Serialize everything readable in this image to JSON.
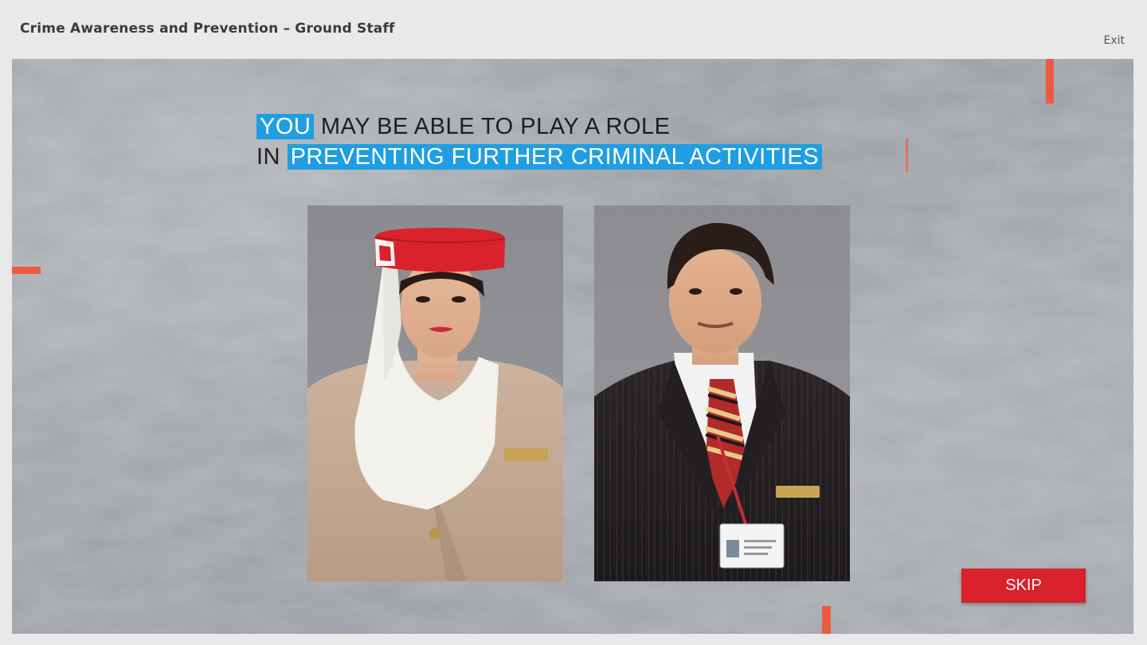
{
  "header": {
    "course_title": "Crime Awareness and Prevention – Ground Staff",
    "exit_label": "Exit"
  },
  "slide": {
    "headline": {
      "line1_highlight": "YOU",
      "line1_rest": " MAY BE ABLE TO PLAY A ROLE",
      "line2_prefix": "IN ",
      "line2_highlight": "PREVENTING FURTHER CRIMINAL ACTIVITIES"
    },
    "photos": [
      {
        "subject": "cabin-crew-member",
        "description": "Cabin crew member in beige uniform with red hat and white veil"
      },
      {
        "subject": "ground-staff-member",
        "description": "Ground staff member in dark pinstripe suit with striped tie and ID badge"
      }
    ],
    "skip_label": "SKIP"
  },
  "colors": {
    "highlight": "#1f9ee3",
    "accent": "#ec5b3f",
    "skip_button": "#d8212b"
  }
}
